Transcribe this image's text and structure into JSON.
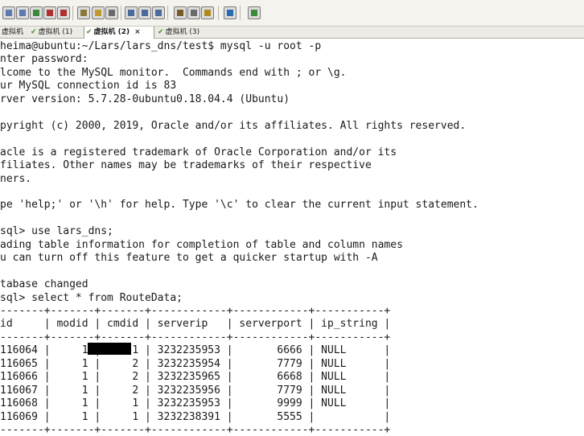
{
  "toolbar": {
    "buttons": [
      {
        "name": "new-tab-icon"
      },
      {
        "name": "duplicate-tab-icon"
      },
      {
        "name": "refresh-icon"
      },
      {
        "name": "close-session-icon"
      },
      {
        "name": "disconnect-icon"
      },
      {
        "name": "copy-icon"
      },
      {
        "name": "paste-icon"
      },
      {
        "name": "find-icon"
      },
      {
        "name": "print-icon"
      },
      {
        "name": "print-setup-icon"
      },
      {
        "name": "print-screen-icon"
      },
      {
        "name": "settings-icon"
      },
      {
        "name": "options-icon"
      },
      {
        "name": "key-icon"
      },
      {
        "name": "help-icon"
      },
      {
        "name": "about-icon"
      }
    ]
  },
  "tabs": [
    {
      "label": "虚拟机",
      "state": "connected"
    },
    {
      "label": "虚拟机 (1)",
      "state": "connected"
    },
    {
      "label": "虚拟机 (2)",
      "state": "connected",
      "active": true,
      "close": "×"
    },
    {
      "label": "虚拟机 (3)",
      "state": "connected"
    }
  ],
  "terminal": {
    "lines": [
      "heima@ubuntu:~/Lars/lars_dns/test$ mysql -u root -p",
      "nter password:",
      "lcome to the MySQL monitor.  Commands end with ; or \\g.",
      "ur MySQL connection id is 83",
      "rver version: 5.7.28-0ubuntu0.18.04.4 (Ubuntu)",
      "",
      "pyright (c) 2000, 2019, Oracle and/or its affiliates. All rights reserved.",
      "",
      "acle is a registered trademark of Oracle Corporation and/or its",
      "filiates. Other names may be trademarks of their respective",
      "ners.",
      "",
      "pe 'help;' or '\\h' for help. Type '\\c' to clear the current input statement.",
      "",
      "sql> use lars_dns;",
      "ading table information for completion of table and column names",
      "u can turn off this feature to get a quicker startup with -A",
      "",
      "tabase changed",
      "sql> select * from RouteData;",
      "-------+-------+-------+------------+------------+-----------+",
      "id     | modid | cmdid | serverip   | serverport | ip_string |",
      "-------+-------+-------+------------+------------+-----------+",
      "116064 |     1 |     1 | 3232235953 |       6666 | NULL      |",
      "116065 |     1 |     2 | 3232235954 |       7779 | NULL      |",
      "116066 |     1 |     2 | 3232235965 |       6668 | NULL      |",
      "116067 |     1 |     2 | 3232235956 |       7779 | NULL      |",
      "116068 |     1 |     1 | 3232235953 |       9999 | NULL      |",
      "116069 |     1 |     1 | 3232238391 |       5555 |           |",
      "-------+-------+-------+------------+------------+-----------+"
    ]
  },
  "colors": {
    "toolbar_bg": "#f4f3ee",
    "tabbar_bg": "#ecebe5",
    "terminal_bg": "#ffffff",
    "terminal_text": "#1a1a1a",
    "tab_check": "#4a8e2c"
  }
}
